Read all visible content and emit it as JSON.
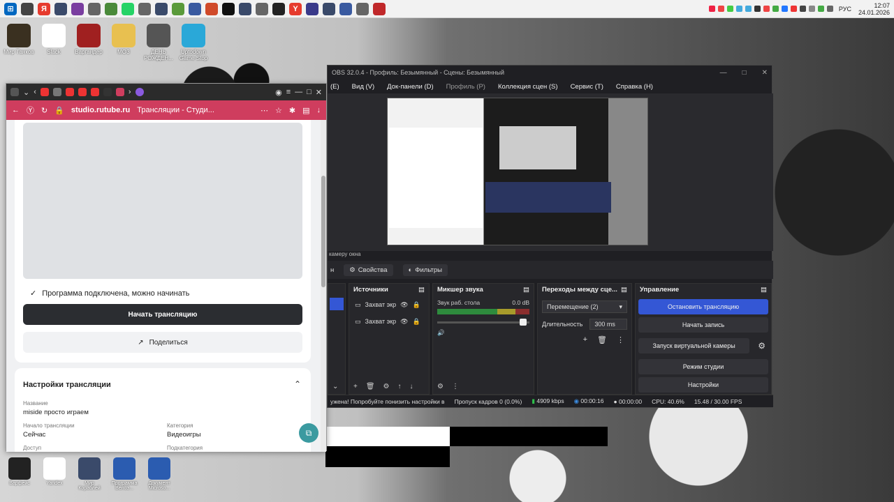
{
  "taskbar": {
    "lang": "РУС",
    "time": "12:07",
    "date": "24.01.2026"
  },
  "desktop_icons": [
    {
      "label": "Мир Танков"
    },
    {
      "label": "Slack"
    },
    {
      "label": "Варгандер"
    },
    {
      "label": "МОЗ"
    },
    {
      "label": "ДЕНЬ РОЖДЕН..."
    },
    {
      "label": "Uptodown Game Stop"
    }
  ],
  "bottom_icons": [
    {
      "label": "Варфейс"
    },
    {
      "label": "Yandex"
    },
    {
      "label": "Мир Кораблей"
    },
    {
      "label": "Программа Велоэ..."
    },
    {
      "label": "Документ Microso..."
    }
  ],
  "browser": {
    "url_domain": "studio.rutube.ru",
    "tab_title": "Трансляции - Студи...",
    "ready_text": "Программа подключена, можно начинать",
    "start_button": "Начать трансляцию",
    "share_button": "Поделиться",
    "settings_title": "Настройки трансляции",
    "name_label": "Название",
    "name_value": "miside просто играем",
    "start_label": "Начало трансляции",
    "start_value": "Сейчас",
    "category_label": "Категория",
    "category_value": "Видеоигры",
    "access_label": "Доступ",
    "subcategory_label": "Подкатегория"
  },
  "obs": {
    "title": "OBS 32.0.4 - Профиль: Безымянный - Сцены: Безымянный",
    "menu": [
      "(E)",
      "Вид (V)",
      "Док-панели (D)",
      "Профиль (P)",
      "Коллекция сцен (S)",
      "Сервис (T)",
      "Справка (H)"
    ],
    "source_caption": "камеру окна",
    "properties": "Свойства",
    "filters": "Фильтры",
    "scenes_tag": "н",
    "sources_title": "Источники",
    "sources": [
      "Захват экр",
      "Захват экр"
    ],
    "mixer_title": "Микшер звука",
    "mixer_channel": "Звук раб. стола",
    "mixer_db": "0.0 dB",
    "transitions_title": "Переходы между сце...",
    "transition_value": "Перемещение (2)",
    "duration_label": "Длительность",
    "duration_value": "300 ms",
    "controls_title": "Управление",
    "controls": [
      "Остановить трансляцию",
      "Начать запись",
      "Запуск виртуальной камеры",
      "Режим студии",
      "Настройки"
    ],
    "status_warning": "ужена! Попробуйте понизить настройки в",
    "dropped": "Пропуск кадров 0 (0.0%)",
    "bitrate": "4909 kbps",
    "stream_time": "00:00:16",
    "rec_time": "00:00:00",
    "cpu": "CPU: 40.6%",
    "fps": "15.48 / 30.00 FPS"
  },
  "colors": {
    "browser_accent": "#cf3d5e",
    "obs_active": "#3457d5"
  }
}
